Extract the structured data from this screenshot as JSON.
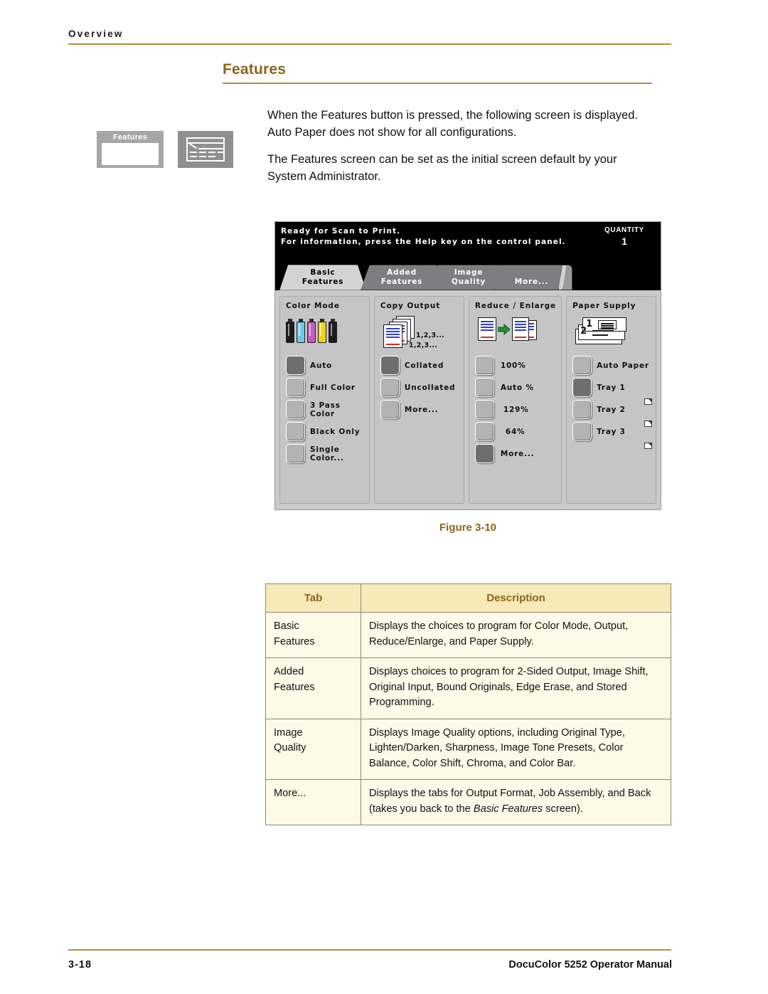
{
  "header": {
    "running_head": "Overview"
  },
  "section": {
    "title": "Features"
  },
  "intro": {
    "features_button_label": "Features",
    "paragraph_1": "When the Features button is pressed, the following screen is displayed.  Auto Paper does not show for all configurations.",
    "paragraph_2": "The Features screen can be set as the initial screen default by your System Administrator."
  },
  "copier_screen": {
    "status_line_1": "Ready for Scan to Print.",
    "status_line_2": "For information, press the Help key on the control panel.",
    "quantity_label": "QUANTITY",
    "quantity_value": "1",
    "tabs": [
      {
        "line1": "Basic",
        "line2": "Features",
        "active": true
      },
      {
        "line1": "Added",
        "line2": "Features",
        "active": false
      },
      {
        "line1": "Image",
        "line2": "Quality",
        "active": false
      },
      {
        "line1": "",
        "line2": "More...",
        "active": false
      }
    ],
    "panels": [
      {
        "title": "Color Mode",
        "icon": "toner-bottles-icon",
        "toner_colors": [
          "#1c1c1c",
          "#6ec8e8",
          "#c05fc0",
          "#f2d21a",
          "#1c1c1c"
        ],
        "options": [
          {
            "label": "Auto",
            "selected": true
          },
          {
            "label": "Full Color",
            "selected": false
          },
          {
            "label": "3 Pass Color",
            "selected": false
          },
          {
            "label": "Black Only",
            "selected": false
          },
          {
            "label": "Single Color...",
            "selected": false
          }
        ]
      },
      {
        "title": "Copy Output",
        "icon": "collated-stack-icon",
        "icon_text_1": "1,2,3...",
        "icon_text_2": "1,2,3...",
        "options": [
          {
            "label": "Collated",
            "selected": true
          },
          {
            "label": "Uncollated",
            "selected": false
          },
          {
            "label": "More...",
            "selected": false
          }
        ]
      },
      {
        "title": "Reduce / Enlarge",
        "icon": "reduce-enlarge-icon",
        "options": [
          {
            "label": "100%",
            "selected": false
          },
          {
            "label": "Auto %",
            "selected": false
          },
          {
            "label": "129%",
            "selected": false
          },
          {
            "label": "64%",
            "selected": false
          },
          {
            "label": "More...",
            "selected": true
          }
        ]
      },
      {
        "title": "Paper Supply",
        "icon": "paper-trays-icon",
        "tray_numbers": [
          "1",
          "2"
        ],
        "options": [
          {
            "label": "Auto Paper",
            "selected": false,
            "flag": false
          },
          {
            "label": "Tray 1",
            "selected": true,
            "flag": true
          },
          {
            "label": "Tray 2",
            "selected": false,
            "flag": true
          },
          {
            "label": "Tray 3",
            "selected": false,
            "flag": true
          }
        ]
      }
    ]
  },
  "figure": {
    "caption": "Figure 3-10"
  },
  "table": {
    "headers": {
      "tab": "Tab",
      "description": "Description"
    },
    "rows": [
      {
        "tab_line1": "Basic",
        "tab_line2": "Features",
        "description": "Displays the choices to program for Color Mode, Output, Reduce/Enlarge, and Paper Supply."
      },
      {
        "tab_line1": "Added",
        "tab_line2": "Features",
        "description": "Displays choices to program for 2-Sided Output, Image Shift, Original Input, Bound Originals, Edge Erase, and Stored Programming."
      },
      {
        "tab_line1": "Image",
        "tab_line2": "Quality",
        "description": "Displays Image Quality options, including Original Type, Lighten/Darken, Sharpness, Image Tone Presets, Color Balance, Color Shift, Chroma, and Color Bar."
      },
      {
        "tab_line1": "More...",
        "tab_line2": "",
        "description_pre": "Displays the tabs for Output Format, Job Assembly, and Back (takes you back to the ",
        "description_em": "Basic Features",
        "description_post": " screen)."
      }
    ]
  },
  "footer": {
    "page_number": "3-18",
    "manual_title": "DocuColor 5252 Operator Manual"
  },
  "colors": {
    "gold_rule": "#b08d3f",
    "heading_gold": "#8a6519",
    "table_header_bg": "#f7e9b8",
    "table_cell_bg": "#fdfae8",
    "panel_bg": "#c5c5c5",
    "screen_bg": "#c9c9c9",
    "status_bg": "#000000"
  }
}
